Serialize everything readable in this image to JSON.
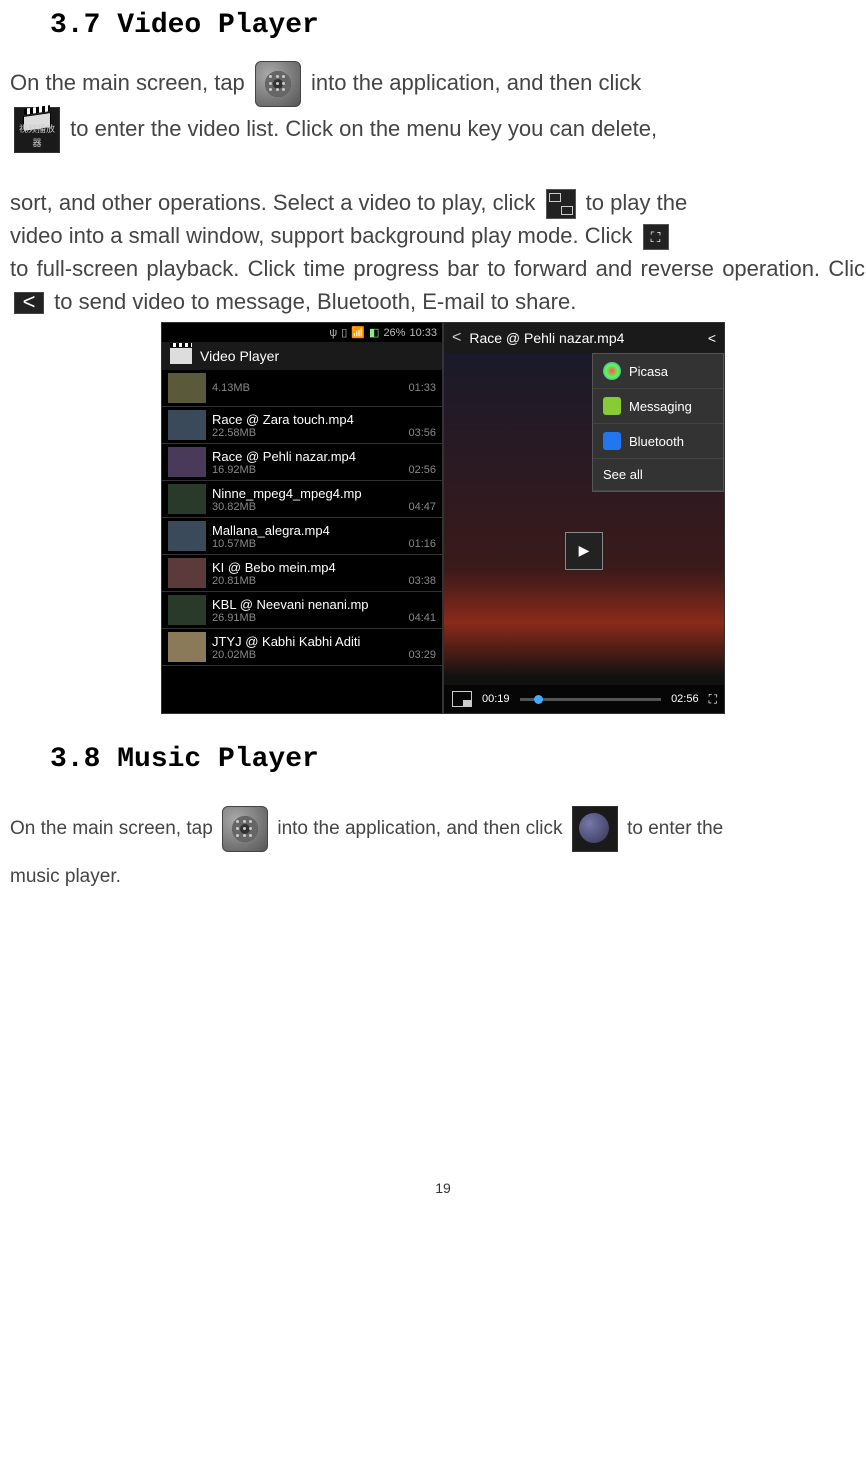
{
  "sections": {
    "videoHeading": "3.7 Video Player",
    "musicHeading": "3.8 Music Player"
  },
  "videoText": {
    "p1a": "On  the  main  screen,  tap ",
    "p1b": "  into  the  application,  and  then  click ",
    "p2a": " to enter the video list. Click on the menu key you can delete, ",
    "p3a": "sort, and other operations. Select a video to play, click ",
    "p3b": " to play the ",
    "p4a": "video into a small window, support background play mode. Click ",
    "p5a": "to full-screen playback. Click time progress bar to forward and reverse operation. Click ",
    "p5b": " to send video to message, Bluetooth, E-mail to share."
  },
  "musicText": {
    "p1a": "On the  main  screen, tap ",
    "p1b": "  into  the  application,  and  then  click ",
    "p1c": "  to  enter  the ",
    "p2": "music player."
  },
  "videoIconLabel": "视频播放器",
  "screenshotLeft": {
    "statusbar": {
      "battery": "26%",
      "time": "10:33"
    },
    "header": "Video Player",
    "items": [
      {
        "name": "",
        "size": "4.13MB",
        "dur": "01:33"
      },
      {
        "name": "Race @ Zara touch.mp4",
        "size": "22.58MB",
        "dur": "03:56"
      },
      {
        "name": "Race @ Pehli nazar.mp4",
        "size": "16.92MB",
        "dur": "02:56"
      },
      {
        "name": "Ninne_mpeg4_mpeg4.mp",
        "size": "30.82MB",
        "dur": "04:47"
      },
      {
        "name": "Mallana_alegra.mp4",
        "size": "10.57MB",
        "dur": "01:16"
      },
      {
        "name": "KI @ Bebo mein.mp4",
        "size": "20.81MB",
        "dur": "03:38"
      },
      {
        "name": "KBL @ Neevani nenani.mp",
        "size": "26.91MB",
        "dur": "04:41"
      },
      {
        "name": "JTYJ @ Kabhi Kabhi Aditi",
        "size": "20.02MB",
        "dur": "03:29"
      }
    ]
  },
  "screenshotRight": {
    "header": "Race @ Pehli nazar.mp4",
    "shareOptions": {
      "picasa": "Picasa",
      "messaging": "Messaging",
      "bluetooth": "Bluetooth",
      "seeAll": "See all"
    },
    "controls": {
      "current": "00:19",
      "total": "02:56"
    }
  },
  "pageNumber": "19"
}
